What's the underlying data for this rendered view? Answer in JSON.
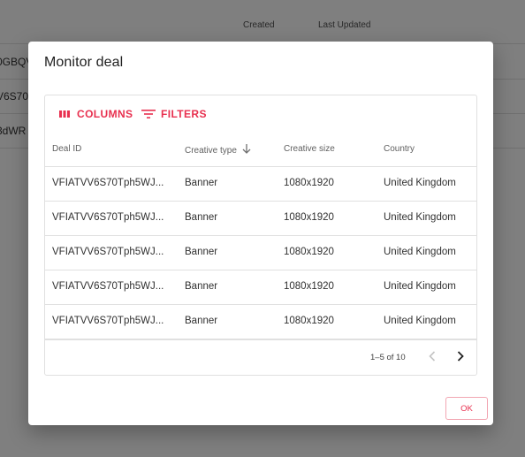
{
  "background": {
    "columns": [
      "Created",
      "Last Updated"
    ],
    "row_fragments": [
      "0GBQV",
      "V6S70T",
      "3dWR"
    ]
  },
  "dialog": {
    "title": "Monitor deal",
    "toolbar": {
      "columns_label": "COLUMNS",
      "filters_label": "FILTERS"
    },
    "headers": {
      "deal_id": "Deal ID",
      "creative_type": "Creative type",
      "creative_size": "Creative size",
      "country": "Country"
    },
    "rows": [
      {
        "deal_id": "VFIATVV6S70Tph5WJ...",
        "creative_type": "Banner",
        "creative_size": "1080x1920",
        "country": "United Kingdom"
      },
      {
        "deal_id": "VFIATVV6S70Tph5WJ...",
        "creative_type": "Banner",
        "creative_size": "1080x1920",
        "country": "United Kingdom"
      },
      {
        "deal_id": "VFIATVV6S70Tph5WJ...",
        "creative_type": "Banner",
        "creative_size": "1080x1920",
        "country": "United Kingdom"
      },
      {
        "deal_id": "VFIATVV6S70Tph5WJ...",
        "creative_type": "Banner",
        "creative_size": "1080x1920",
        "country": "United Kingdom"
      },
      {
        "deal_id": "VFIATVV6S70Tph5WJ...",
        "creative_type": "Banner",
        "creative_size": "1080x1920",
        "country": "United Kingdom"
      }
    ],
    "pagination": {
      "range_text": "1–5 of 10"
    },
    "ok_label": "OK"
  },
  "colors": {
    "accent": "#e8304f",
    "scrim": "rgba(0,0,0,0.5)",
    "border": "#e0e0e0"
  },
  "icons": {
    "columns": "columns-icon",
    "filters": "filter-icon",
    "sort": "arrow-down-icon",
    "prev": "chevron-left-icon",
    "next": "chevron-right-icon"
  }
}
